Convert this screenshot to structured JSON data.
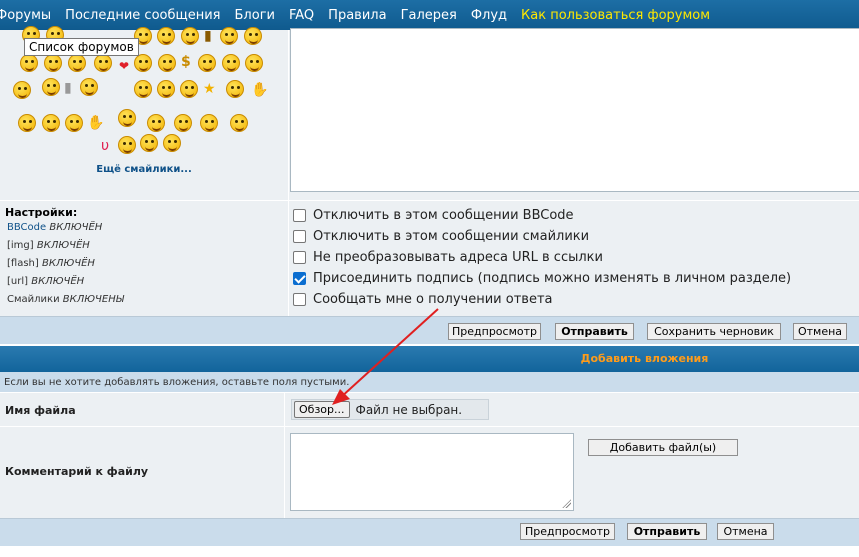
{
  "nav": {
    "items": [
      "Форумы",
      "Последние сообщения",
      "Блоги",
      "FAQ",
      "Правила",
      "Галерея",
      "Флуд"
    ],
    "highlight": "Как пользоваться форумом",
    "highlight_color": "#ffe800"
  },
  "tooltip": "Список форумов",
  "smilies": {
    "more_label": "Ещё смайлики..."
  },
  "settings": {
    "title": "Настройки:",
    "lines": [
      {
        "key": "BBCode",
        "value": "ВКЛЮЧЁН"
      },
      {
        "key": "[img]",
        "value": "ВКЛЮЧЁН"
      },
      {
        "key": "[flash]",
        "value": "ВКЛЮЧЁН"
      },
      {
        "key": "[url]",
        "value": "ВКЛЮЧЁН"
      },
      {
        "key": "Смайлики",
        "value": "ВКЛЮЧЕНЫ"
      }
    ]
  },
  "options": [
    {
      "label": "Отключить в этом сообщении BBCode",
      "checked": false
    },
    {
      "label": "Отключить в этом сообщении смайлики",
      "checked": false
    },
    {
      "label": "Не преобразовывать адреса URL в ссылки",
      "checked": false
    },
    {
      "label": "Присоединить подпись (подпись можно изменять в личном разделе)",
      "checked": true
    },
    {
      "label": "Сообщать мне о получении ответа",
      "checked": false
    }
  ],
  "post_buttons": {
    "preview": "Предпросмотр",
    "submit": "Отправить",
    "save_draft": "Сохранить черновик",
    "cancel": "Отмена"
  },
  "attachments": {
    "title": "Добавить вложения",
    "note": "Если вы не хотите добавлять вложения, оставьте поля пустыми.",
    "file_label": "Имя файла",
    "browse_label": "Обзор...",
    "no_file": "Файл не выбран.",
    "comment_label": "Комментарий к файлу",
    "add_file": "Добавить файл(ы)",
    "title_color": "#ff9c1a"
  },
  "bottom_buttons": {
    "preview": "Предпросмотр",
    "submit": "Отправить",
    "cancel": "Отмена"
  },
  "annotation": {
    "arrow_color": "#e02020"
  }
}
